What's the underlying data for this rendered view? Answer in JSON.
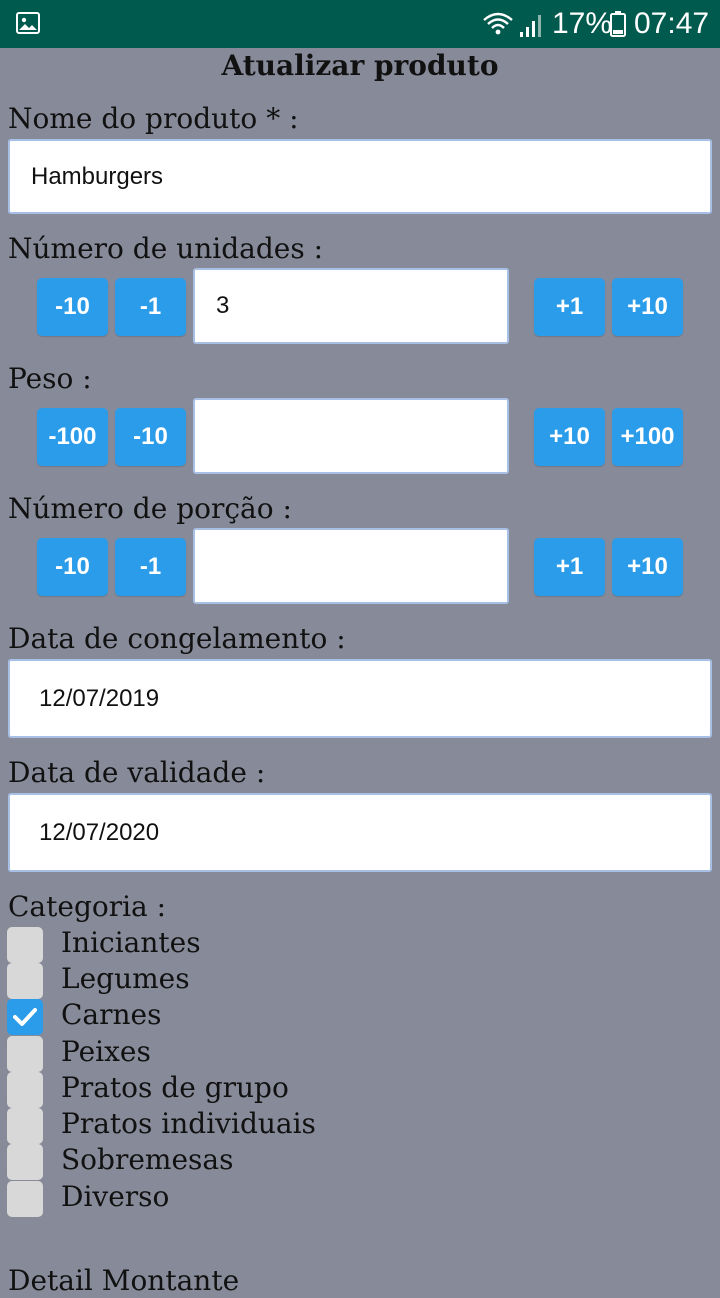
{
  "status_bar": {
    "battery": "17%",
    "time": "07:47",
    "bg_color": "#005a4e"
  },
  "page": {
    "title": "Atualizar produto"
  },
  "product_name": {
    "label": "Nome do produto * :",
    "value": "Hamburgers"
  },
  "units": {
    "label": "Número de unidades :",
    "value": "3",
    "buttons": [
      "-10",
      "-1",
      "+1",
      "+10"
    ]
  },
  "weight": {
    "label": "Peso :",
    "value": "",
    "buttons": [
      "-100",
      "-10",
      "+10",
      "+100"
    ]
  },
  "portions": {
    "label": "Número de porção :",
    "value": "",
    "buttons": [
      "-10",
      "-1",
      "+1",
      "+10"
    ]
  },
  "freeze_date": {
    "label": "Data de congelamento :",
    "value": "12/07/2019"
  },
  "expiry_date": {
    "label": "Data de validade :",
    "value": "12/07/2020"
  },
  "category": {
    "label": "Categoria :",
    "items": [
      {
        "label": "Iniciantes",
        "checked": false
      },
      {
        "label": "Legumes",
        "checked": false
      },
      {
        "label": "Carnes",
        "checked": true
      },
      {
        "label": "Peixes",
        "checked": false
      },
      {
        "label": "Pratos de grupo",
        "checked": false
      },
      {
        "label": "Pratos individuais",
        "checked": false
      },
      {
        "label": "Sobremesas",
        "checked": false
      },
      {
        "label": "Diverso",
        "checked": false
      }
    ]
  },
  "footer_partial": "Detail Montante",
  "colors": {
    "accent": "#2b9ce9",
    "background": "#878b99",
    "input_border": "#a9c0e6"
  }
}
